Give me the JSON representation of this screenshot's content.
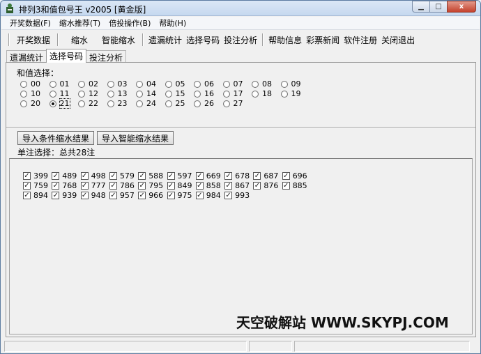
{
  "window": {
    "title": "排列3和值包号王 v2005 [黄金版]",
    "minimize": "0",
    "maximize": "□",
    "close": "x"
  },
  "menu": [
    "开奖数据(F)",
    "缩水推荐(T)",
    "倍投操作(B)",
    "帮助(H)"
  ],
  "toolbar": {
    "group1": [
      "开奖数据"
    ],
    "group2": [
      "缩水",
      "智能缩水"
    ],
    "group3": [
      "遗漏统计",
      "选择号码",
      "投注分析"
    ],
    "group4": [
      "帮助信息",
      "彩票新闻",
      "软件注册",
      "关闭退出"
    ]
  },
  "tabs": [
    {
      "label": "遗漏统计",
      "active": false
    },
    {
      "label": "选择号码",
      "active": true
    },
    {
      "label": "投注分析",
      "active": false
    }
  ],
  "sum_group": {
    "label": "和值选择：",
    "options": [
      "00",
      "01",
      "02",
      "03",
      "04",
      "05",
      "06",
      "07",
      "08",
      "09",
      "10",
      "11",
      "12",
      "13",
      "14",
      "15",
      "16",
      "17",
      "18",
      "19",
      "20",
      "21",
      "22",
      "23",
      "24",
      "25",
      "26",
      "27"
    ],
    "selected": "21"
  },
  "buttons": {
    "import_condition": "导入条件缩水结果",
    "import_smart": "导入智能缩水结果"
  },
  "single_note": "单注选择：总共28注",
  "numbers": [
    "399",
    "489",
    "498",
    "579",
    "588",
    "597",
    "669",
    "678",
    "687",
    "696",
    "759",
    "768",
    "777",
    "786",
    "795",
    "849",
    "858",
    "867",
    "876",
    "885",
    "894",
    "939",
    "948",
    "957",
    "966",
    "975",
    "984",
    "993"
  ],
  "watermark": "天空破解站 WWW.SKYPJ.COM"
}
